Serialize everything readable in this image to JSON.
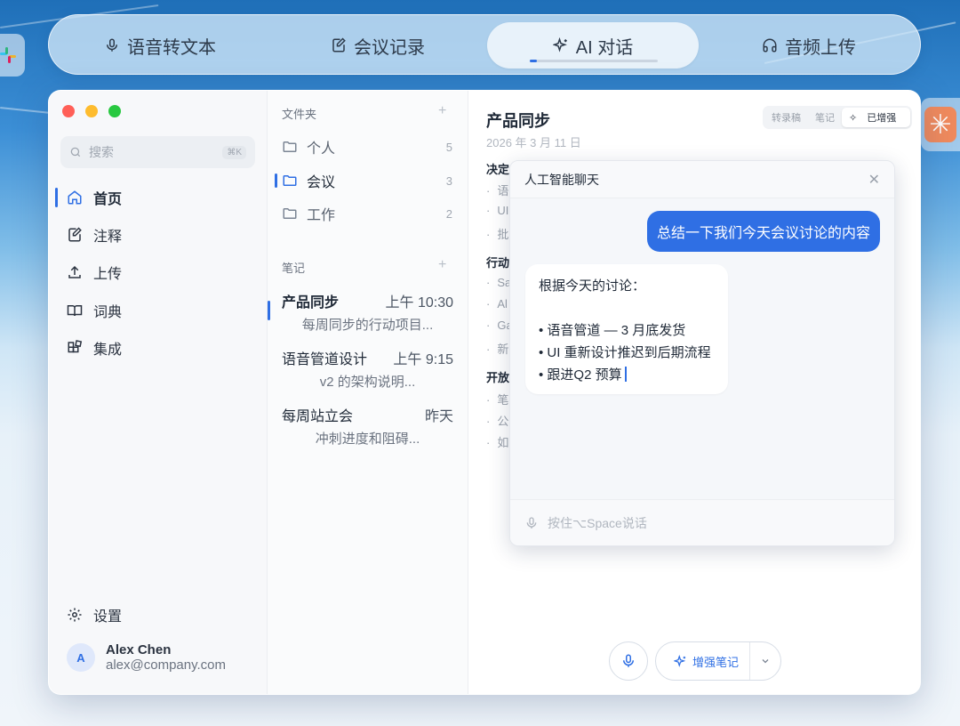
{
  "top_nav": {
    "tabs": [
      {
        "label": "语音转文本",
        "icon": "mic-icon"
      },
      {
        "label": "会议记录",
        "icon": "notebook-edit-icon"
      },
      {
        "label": "AI 对话",
        "icon": "sparkles-icon",
        "active": true
      },
      {
        "label": "音频上传",
        "icon": "headphones-icon"
      }
    ]
  },
  "sidebar": {
    "search_placeholder": "搜索",
    "search_shortcut": "⌘K",
    "items": [
      {
        "label": "首页",
        "icon": "home-icon",
        "active": true
      },
      {
        "label": "注释",
        "icon": "annotate-icon"
      },
      {
        "label": "上传",
        "icon": "upload-icon"
      },
      {
        "label": "词典",
        "icon": "book-icon"
      },
      {
        "label": "集成",
        "icon": "integrations-icon"
      }
    ],
    "settings_label": "设置",
    "user": {
      "initial": "A",
      "name": "Alex Chen",
      "email": "alex@company.com"
    }
  },
  "notes_panel": {
    "folders_label": "文件夹",
    "folders": [
      {
        "name": "个人",
        "count": "5"
      },
      {
        "name": "会议",
        "count": "3",
        "active": true
      },
      {
        "name": "工作",
        "count": "2"
      }
    ],
    "notes_label": "笔记",
    "notes": [
      {
        "title": "产品同步",
        "time": "上午 10:30",
        "snippet": "每周同步的行动项目...",
        "active": true
      },
      {
        "title": "语音管道设计",
        "time": "上午 9:15",
        "snippet": "v2 的架构说明..."
      },
      {
        "title": "每周站立会",
        "time": "昨天",
        "snippet": "冲刺进度和阻碍..."
      }
    ]
  },
  "document": {
    "title": "产品同步",
    "date": "2026 年 3 月 11 日",
    "view_modes": [
      "转录稿",
      "笔记",
      "已增强"
    ],
    "active_mode": "已增强",
    "sections": [
      {
        "heading": "决定",
        "bullets": [
          "语",
          "UI",
          "批"
        ]
      },
      {
        "heading": "行动",
        "bullets": [
          "Sa",
          "Al",
          "Ga",
          "新"
        ]
      },
      {
        "heading": "开放",
        "bullets": [
          "笔",
          "公",
          "如"
        ]
      }
    ]
  },
  "chat": {
    "title": "人工智能聊天",
    "user_message": "总结一下我们今天会议讨论的内容",
    "ai_intro": "根据今天的讨论：",
    "ai_bullets": [
      "• 语音管道 — 3 月底发货",
      "• UI 重新设计推迟到后期流程",
      "• 跟进Q2 预算"
    ],
    "input_placeholder": "按住⌥Space说话"
  },
  "actions": {
    "enhance_label": "增强笔记"
  },
  "colors": {
    "accent": "#2f6fe4",
    "close": "#ff5f57",
    "minimize": "#febc2e",
    "maximize": "#28c840"
  }
}
